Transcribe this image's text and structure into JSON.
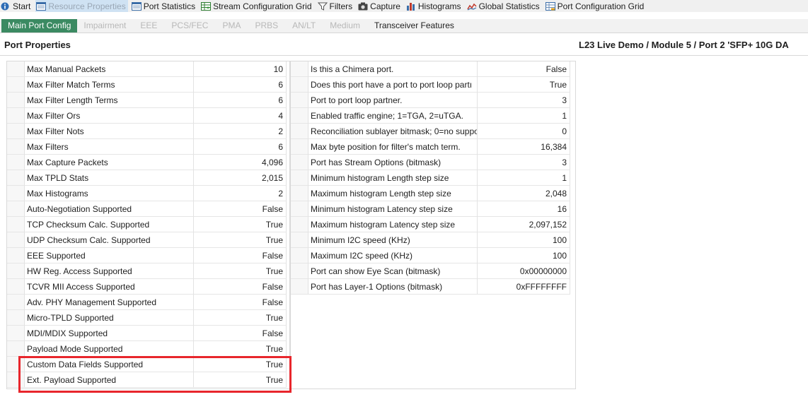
{
  "toolbar": {
    "tabs": [
      {
        "label": "Start",
        "icon": "info-icon"
      },
      {
        "label": "Resource Properties",
        "icon": "properties-icon",
        "active": true
      },
      {
        "label": "Port Statistics",
        "icon": "table-icon"
      },
      {
        "label": "Stream Configuration Grid",
        "icon": "stream-grid-icon"
      },
      {
        "label": "Filters",
        "icon": "filter-icon"
      },
      {
        "label": "Capture",
        "icon": "camera-icon"
      },
      {
        "label": "Histograms",
        "icon": "histogram-icon"
      },
      {
        "label": "Global Statistics",
        "icon": "chart-icon"
      },
      {
        "label": "Port Configuration Grid",
        "icon": "grid-icon"
      }
    ]
  },
  "subtabs": [
    {
      "label": "Main Port Config",
      "state": "active"
    },
    {
      "label": "Impairment",
      "state": "disabled"
    },
    {
      "label": "EEE",
      "state": "disabled"
    },
    {
      "label": "PCS/FEC",
      "state": "disabled"
    },
    {
      "label": "PMA",
      "state": "disabled"
    },
    {
      "label": "PRBS",
      "state": "disabled"
    },
    {
      "label": "AN/LT",
      "state": "disabled"
    },
    {
      "label": "Medium",
      "state": "disabled"
    },
    {
      "label": "Transceiver Features",
      "state": "enabled"
    }
  ],
  "header": {
    "title": "Port Properties",
    "path": "L23 Live Demo / Module 5 / Port 2 'SFP+ 10G DA"
  },
  "left_grid": [
    {
      "name": "Max Manual Packets",
      "value": "10"
    },
    {
      "name": "Max Filter Match Terms",
      "value": "6"
    },
    {
      "name": "Max Filter Length Terms",
      "value": "6"
    },
    {
      "name": "Max Filter Ors",
      "value": "4"
    },
    {
      "name": "Max Filter Nots",
      "value": "2"
    },
    {
      "name": "Max Filters",
      "value": "6"
    },
    {
      "name": "Max Capture Packets",
      "value": "4,096"
    },
    {
      "name": "Max TPLD Stats",
      "value": "2,015"
    },
    {
      "name": "Max Histograms",
      "value": "2"
    },
    {
      "name": "Auto-Negotiation Supported",
      "value": "False"
    },
    {
      "name": "TCP Checksum Calc. Supported",
      "value": "True"
    },
    {
      "name": "UDP Checksum Calc. Supported",
      "value": "True"
    },
    {
      "name": "EEE Supported",
      "value": "False"
    },
    {
      "name": "HW Reg. Access Supported",
      "value": "True"
    },
    {
      "name": "TCVR MII Access Supported",
      "value": "False"
    },
    {
      "name": "Adv. PHY Management Supported",
      "value": "False"
    },
    {
      "name": "Micro-TPLD Supported",
      "value": "True"
    },
    {
      "name": "MDI/MDIX Supported",
      "value": "False"
    },
    {
      "name": "Payload Mode Supported",
      "value": "True"
    },
    {
      "name": "Custom Data Fields Supported",
      "value": "True"
    },
    {
      "name": "Ext. Payload Supported",
      "value": "True"
    }
  ],
  "right_grid": [
    {
      "name": "Is this a Chimera port.",
      "value": "False"
    },
    {
      "name": "Does this port have a port to port loop partı",
      "value": "True"
    },
    {
      "name": "Port to port loop partner.",
      "value": "3"
    },
    {
      "name": "Enabled traffic engine; 1=TGA, 2=uTGA.",
      "value": "1"
    },
    {
      "name": "Reconciliation sublayer bitmask; 0=no suppo",
      "value": "0"
    },
    {
      "name": "Max byte position for filter's match term.",
      "value": "16,384"
    },
    {
      "name": "Port has Stream Options (bitmask)",
      "value": "3"
    },
    {
      "name": "Minimum histogram Length step size",
      "value": "1"
    },
    {
      "name": "Maximum histogram Length step size",
      "value": "2,048"
    },
    {
      "name": "Minimum histogram Latency step size",
      "value": "16"
    },
    {
      "name": "Maximum histogram Latency step size",
      "value": "2,097,152"
    },
    {
      "name": "Minimum I2C speed (KHz)",
      "value": "100"
    },
    {
      "name": "Maximum I2C speed (KHz)",
      "value": "100"
    },
    {
      "name": "Port can show Eye Scan (bitmask)",
      "value": "0x00000000"
    },
    {
      "name": "Port has Layer-1 Options (bitmask)",
      "value": "0xFFFFFFFF"
    }
  ],
  "colors": {
    "active_subtab": "#3b8a62",
    "highlight": "#e8262c",
    "active_toolbar_tab": "#cfe2f3"
  }
}
